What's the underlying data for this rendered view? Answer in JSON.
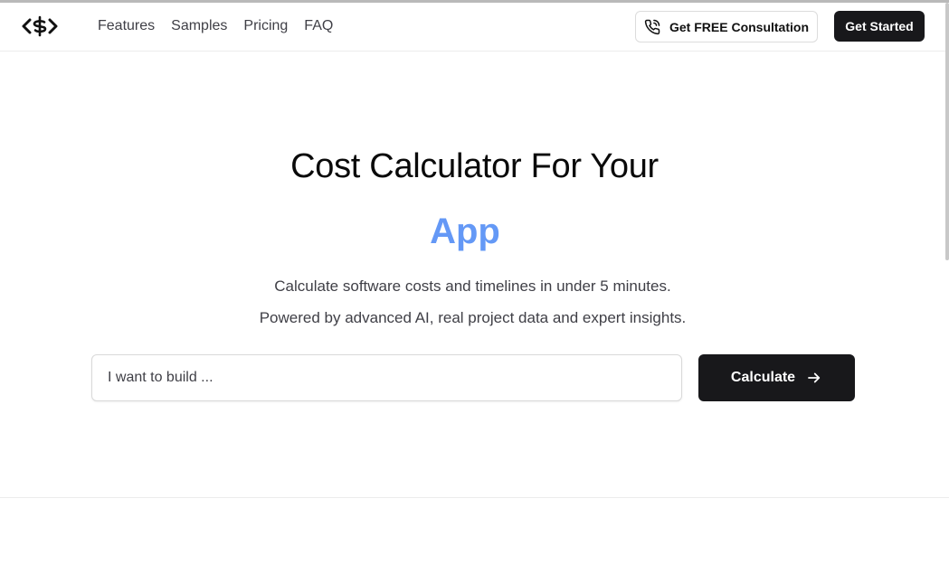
{
  "header": {
    "logo_icon": "dollar-code-logo",
    "nav": [
      {
        "label": "Features"
      },
      {
        "label": "Samples"
      },
      {
        "label": "Pricing"
      },
      {
        "label": "FAQ"
      }
    ],
    "consult_label": "Get FREE Consultation",
    "consult_icon": "phone-icon",
    "start_label": "Get Started"
  },
  "hero": {
    "title": "Cost Calculator For Your",
    "accent": "App",
    "subtitle_line1": "Calculate software costs and timelines in under 5 minutes.",
    "subtitle_line2": "Powered by advanced AI, real project data and expert insights.",
    "input_placeholder": "I want to build ...",
    "input_value": "",
    "calculate_label": "Calculate",
    "calculate_icon": "arrow-right-icon"
  },
  "colors": {
    "primary_dark": "#18181b",
    "accent_blue": "#5e8ef5"
  }
}
